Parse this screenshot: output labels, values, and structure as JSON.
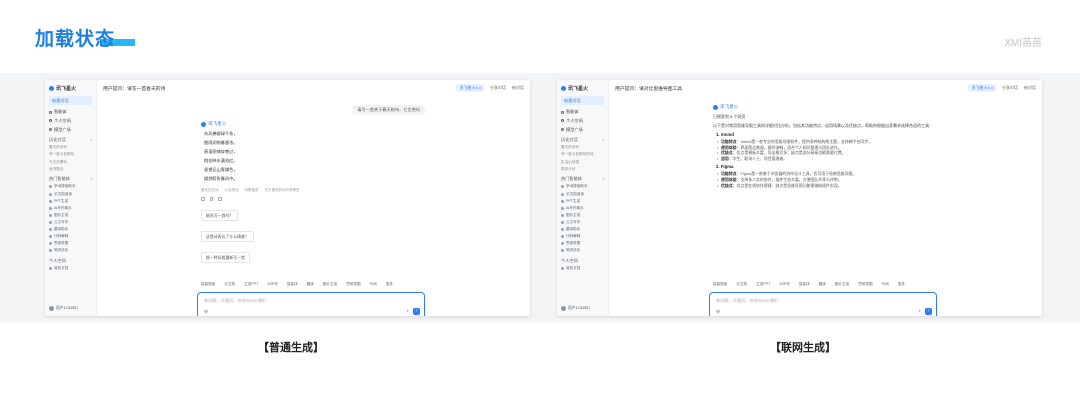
{
  "page": {
    "title": "加载状态",
    "brand": "XMI苗苗"
  },
  "captions": {
    "left": "【普通生成】",
    "right": "【联网生成】"
  },
  "sidebar": {
    "app_name": "讯飞星火",
    "new_chat": "新建对话",
    "nav": [
      "智能体",
      "个人空间",
      "模型广场"
    ],
    "history_head": "历史对话",
    "history_right": [
      "春天的诗句",
      "写一首七言绝句的诗",
      "生活小妙招",
      "周末计划"
    ],
    "history_left": [
      "春天的诗句",
      "写一首七言绝句",
      "今天去哪玩",
      "读书笔记"
    ],
    "tools_head": "热门智能体",
    "tools": [
      "学术搜索助手",
      "长文档阅读",
      "PPT生成",
      "AI写作助手",
      "图片生成",
      "公文写作",
      "翻译助手",
      "代码解释",
      "思维导图",
      "简历优化"
    ],
    "bottom_head": "个人空间",
    "bottom_item": "我的文档",
    "user": "用户1234567"
  },
  "topbar_left": {
    "title": "用户提问：请写一首春天的诗",
    "badge": "讯飞星火4.0",
    "actions": [
      "分享对话",
      "新对话"
    ]
  },
  "topbar_right": {
    "title": "用户提问：请对比思维导图工具",
    "badge": "讯飞星火4.0",
    "actions": [
      "分享对话",
      "新对话"
    ]
  },
  "chat_left": {
    "user_message": "请写一首关于春天的诗，七言绝句",
    "ai_name": "讯飞星火",
    "poem": [
      "东风拂柳绿千条，",
      "细雨润物春意浓。",
      "燕语呢喃穿巷过，",
      "桃花映水满池红。",
      "遥望远山青黛色，",
      "嫣然醉卧春风中。"
    ],
    "refs": [
      "春天的古诗",
      "七言绝句",
      "诗歌鉴赏",
      "关于春天的诗句有哪些"
    ],
    "follow_ups": [
      "能再写一首吗？",
      "这首诗表达了什么情感？",
      "换一种风格重新写一首"
    ]
  },
  "chat_right": {
    "ai_name": "讯飞星火",
    "search_note": "已搜索到 8 个网页",
    "intro": "以下是对常用思维导图工具的详细对比分析，包括其功能特点、适用场景以及优缺点，帮助你根据自身需求选择合适的工具：",
    "sections": [
      {
        "heading": "1. Xmind",
        "bullets": [
          [
            "功能特点",
            "：Xmind是一款专业的思维导图软件，提供多种结构和主题，支持跨平台同步。"
          ],
          [
            "使用体验",
            "：界面简洁美观，操作流畅，适合个人知识整理与团队协作。"
          ],
          [
            "优缺点",
            "：优点是模板丰富、导出格式多；缺点是部分高级功能需要付费。"
          ],
          [
            "适用",
            "：学生、职场人士、项目管理者。"
          ]
        ]
      },
      {
        "heading": "2. Figma",
        "bullets": [
          [
            "功能特点",
            "：Figma是一款基于浏览器的协作设计工具，也可用于绘制思维导图。"
          ],
          [
            "使用体验",
            "：支持多人实时协作，插件生态丰富，方便团队共享与评审。"
          ],
          [
            "优缺点",
            "：优点是在线协作便捷；缺点是思维导图功能需借助插件实现。"
          ]
        ]
      }
    ]
  },
  "tools_row": [
    "智能搜索",
    "长文档",
    "生成PPT",
    "AI写作",
    "智能体",
    "翻译",
    "图片生成",
    "思维导图",
    "代码",
    "更多"
  ],
  "input": {
    "placeholder": "有问题，尽管问，Shift+Enter换行"
  }
}
